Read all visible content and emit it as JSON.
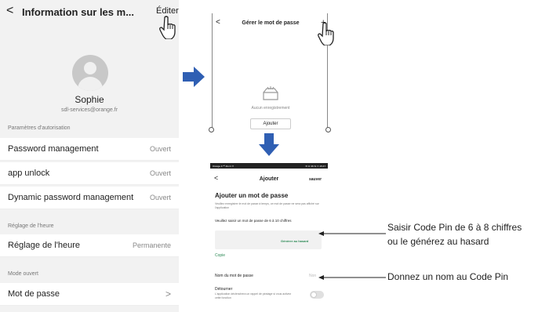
{
  "screen1": {
    "back_glyph": "<",
    "title": "Information sur les m...",
    "edit_label": "Éditer",
    "user_name": "Sophie",
    "user_email": "sdl-services@orange.fr",
    "sections": {
      "auth": "Paramètres d'autorisation",
      "time": "Réglage de l'heure",
      "mode": "Mode ouvert"
    },
    "rows": [
      {
        "label": "Password management",
        "value": "Ouvert"
      },
      {
        "label": "app unlock",
        "value": "Ouvert"
      },
      {
        "label": "Dynamic password management",
        "value": "Ouvert"
      },
      {
        "label": "Réglage de l'heure",
        "value": "Permanente"
      },
      {
        "label": "Mot de passe",
        "value": ">"
      }
    ]
  },
  "screen2": {
    "back_glyph": "<",
    "title": "Gérer le mot de passe",
    "plus_glyph": "+",
    "empty_text": "Aucun enregistrement",
    "add_button": "Ajouter"
  },
  "screen3": {
    "status_left": "Orange F  ᵃᵗˡ 4G ⊡ ✈",
    "status_right": "✉ ⊡ 36 % ▭ 15:47",
    "back_glyph": "<",
    "title": "Ajouter",
    "save": "sauver",
    "heading": "Ajouter un mot de passe",
    "hint": "Veuillez enregistrer le mot de passe à temps, ce mot de passe ne sera pas affiché sur l'application",
    "pin_label": "Veuillez saisir un mot de passe de 6 à 10 chiffres",
    "generate": "Générer au hasard",
    "copy": "Copie",
    "name_label": "Nom du mot de passe",
    "name_placeholder": "Non",
    "detour_label": "Détourner",
    "detour_hint": "L'application déclenchera un rappel de piratage si vous activez cette fonction"
  },
  "annotations": {
    "pin_line1": "Saisir Code Pin de 6 à 8 chiffres",
    "pin_line2": "ou le générez au hasard",
    "name": "Donnez un nom au Code Pin"
  },
  "colors": {
    "arrow": "#2f5fb3",
    "generate": "#2e8b57",
    "copy": "#2e8b57"
  }
}
